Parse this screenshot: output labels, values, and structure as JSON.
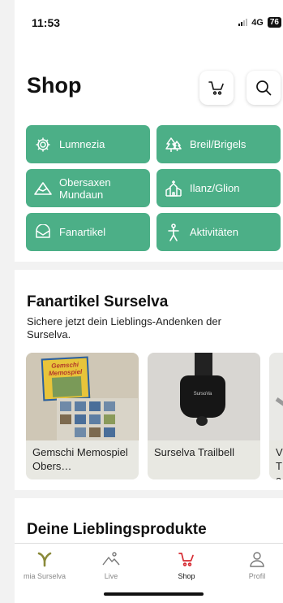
{
  "status": {
    "time": "11:53",
    "network": "4G",
    "battery": "76"
  },
  "header": {
    "title": "Shop"
  },
  "categories": [
    {
      "label": "Lumnezia",
      "icon": "gear-icon"
    },
    {
      "label": "Breil/Brigels",
      "icon": "trees-icon"
    },
    {
      "label": "Obersaxen Mundaun",
      "icon": "mountain-icon"
    },
    {
      "label": "Ilanz/Glion",
      "icon": "church-icon"
    },
    {
      "label": "Fanartikel",
      "icon": "cap-icon"
    },
    {
      "label": "Aktivitäten",
      "icon": "person-icon"
    }
  ],
  "fanartikel": {
    "title": "Fanartikel Surselva",
    "subtitle": "Sichere jetzt dein Lieblings-Andenken der Surselva.",
    "cards": [
      {
        "label": "Gemschi Memospiel Obers…",
        "box_text": "Gemschi Memospiel"
      },
      {
        "label": "Surselva Trailbell",
        "product_mark": "SursoVa"
      },
      {
        "label": "V Ta"
      }
    ]
  },
  "favorites": {
    "title": "Deine Lieblingsprodukte"
  },
  "tabs": [
    {
      "label": "mia Surselva",
      "icon": "surselva-logo-icon"
    },
    {
      "label": "Live",
      "icon": "mountain-icon"
    },
    {
      "label": "Shop",
      "icon": "cart-icon"
    },
    {
      "label": "Profil",
      "icon": "person-icon"
    }
  ],
  "colors": {
    "accent": "#4caf87",
    "active_tab": "#d62b32",
    "logo": "#8a8a3a"
  }
}
